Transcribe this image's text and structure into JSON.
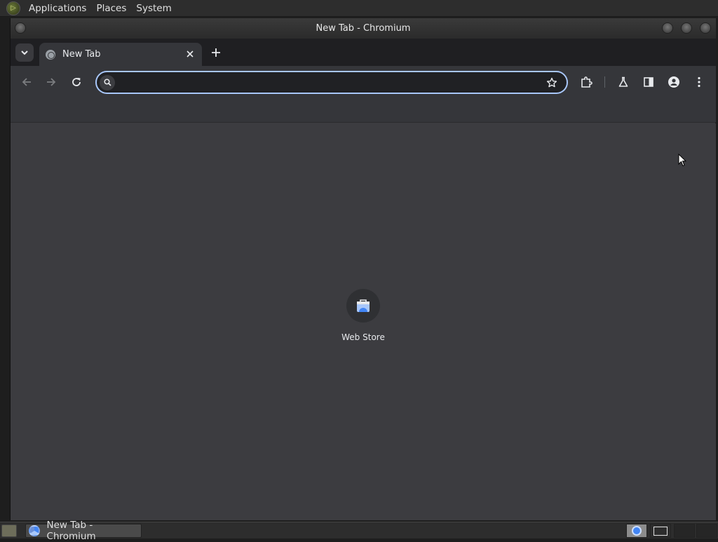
{
  "top_panel": {
    "menus": [
      "Applications",
      "Places",
      "System"
    ]
  },
  "window": {
    "title": "New Tab - Chromium"
  },
  "tabs": [
    {
      "label": "New Tab",
      "active": true
    }
  ],
  "omnibox": {
    "value": "",
    "placeholder": ""
  },
  "shortcuts": [
    {
      "label": "Web Store",
      "icon": "web-store-icon"
    }
  ],
  "taskbar": {
    "task_label": "New Tab - Chromium"
  },
  "colors": {
    "accent": "#a8c7fa",
    "content_bg": "#3c3c40",
    "toolbar_bg": "#35363a"
  }
}
